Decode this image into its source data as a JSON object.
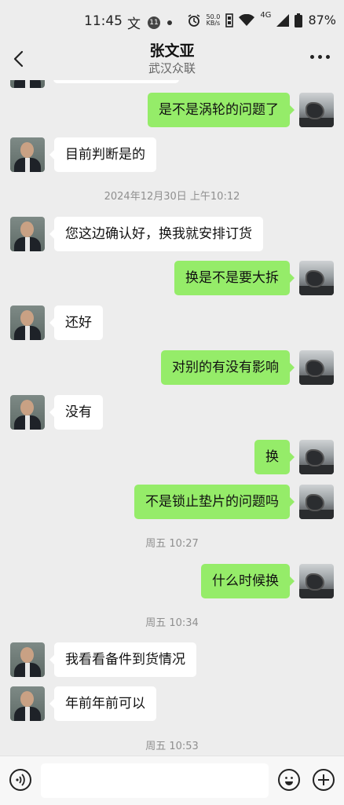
{
  "status_bar": {
    "time": "11:45",
    "badge_count": "11",
    "net_speed_value": "50.0",
    "net_speed_unit": "KB/s",
    "network": "4G",
    "battery": "87%"
  },
  "header": {
    "title": "张文亚",
    "subtitle": "武汉众联"
  },
  "messages": [
    {
      "side": "right",
      "text": "是不是涡轮的问题了"
    },
    {
      "side": "left",
      "text": "目前判断是的"
    },
    {
      "type": "time",
      "text": "2024年12月30日 上午10:12"
    },
    {
      "side": "left",
      "text": "您这边确认好，换我就安排订货"
    },
    {
      "side": "right",
      "text": "换是不是要大拆"
    },
    {
      "side": "left",
      "text": "还好"
    },
    {
      "side": "right",
      "text": "对别的有没有影响"
    },
    {
      "side": "left",
      "text": "没有"
    },
    {
      "side": "right",
      "text": "换"
    },
    {
      "side": "right",
      "text": "不是锁止垫片的问题吗"
    },
    {
      "type": "time",
      "text": "周五 10:27"
    },
    {
      "side": "right",
      "text": "什么时候换"
    },
    {
      "type": "time",
      "text": "周五 10:34"
    },
    {
      "side": "left",
      "text": "我看看备件到货情况"
    },
    {
      "side": "left",
      "text": "年前年前可以"
    },
    {
      "type": "time",
      "text": "周五 10:53"
    }
  ],
  "icons": {
    "status": [
      "translate-icon",
      "notification-badge",
      "dot-icon",
      "alarm-icon",
      "data-saver-icon",
      "wifi-icon",
      "signal-icon",
      "battery-icon"
    ],
    "header": [
      "back-arrow-icon",
      "more-icon"
    ],
    "input": [
      "voice-icon",
      "emoji-icon",
      "plus-icon"
    ]
  },
  "colors": {
    "background": "#ededed",
    "bubble_sent": "#95ec69",
    "bubble_received": "#ffffff",
    "timestamp": "#8f8f8f"
  }
}
